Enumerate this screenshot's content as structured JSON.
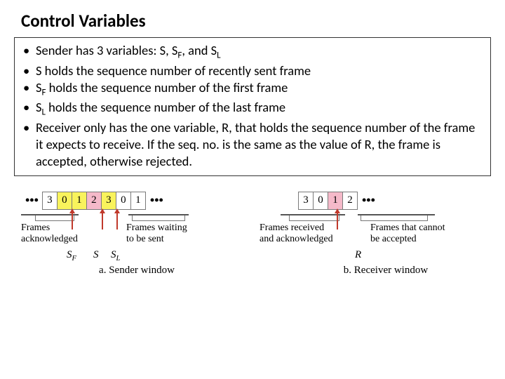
{
  "title": "Control Variables",
  "bullets": [
    "Sender has 3 variables: S, S<sub>F</sub>, and S<sub>L</sub>",
    "S holds the sequence number of recently sent frame",
    "S<sub>F</sub> holds the sequence number of the first frame",
    "S<sub>L</sub> holds the sequence number of the last frame",
    "Receiver only has the one variable, R, that holds the sequence number of the frame it expects to receive. If the seq. no. is the same as the value of R, the frame is accepted, otherwise rejected."
  ],
  "sender": {
    "cells": [
      "3",
      "0",
      "1",
      "2",
      "3",
      "0",
      "1"
    ],
    "label_left": "Frames\nacknowledged",
    "label_right": "Frames waiting\nto be sent",
    "ptr_sf": "S<sub>F</sub>",
    "ptr_s": "S",
    "ptr_sl": "S<sub>L</sub>",
    "caption": "a. Sender window"
  },
  "receiver": {
    "cells": [
      "3",
      "0",
      "1",
      "2"
    ],
    "label_left": "Frames received\nand acknowledged",
    "label_right": "Frames that cannot\nbe accepted",
    "ptr_r": "R",
    "caption": "b. Receiver window"
  }
}
